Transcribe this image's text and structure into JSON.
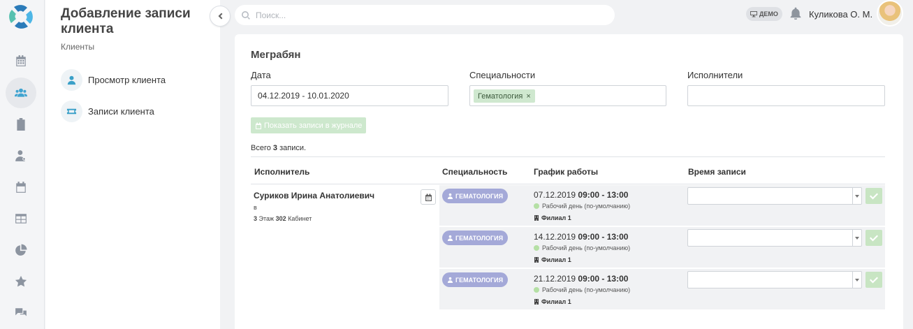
{
  "sidebar": {
    "items": [
      {
        "icon": "calendar-icon",
        "active": false
      },
      {
        "icon": "users-icon",
        "active": true
      },
      {
        "icon": "clipboard-icon",
        "active": false
      },
      {
        "icon": "user-doctor-icon",
        "active": false
      },
      {
        "icon": "calendar-schedule-icon",
        "active": false
      },
      {
        "icon": "table-icon",
        "active": false
      },
      {
        "icon": "pie-chart-icon",
        "active": false
      },
      {
        "icon": "star-icon",
        "active": false
      },
      {
        "icon": "chat-icon",
        "active": false
      }
    ]
  },
  "panel": {
    "title": "Добавление записи клиента",
    "subtitle": "Клиенты",
    "links": [
      {
        "label": "Просмотр клиента",
        "icon": "user-icon"
      },
      {
        "label": "Записи клиента",
        "icon": "ticket-icon"
      }
    ]
  },
  "header": {
    "search_placeholder": "Поиск...",
    "demo_label": "ДЕМО",
    "user_name": "Куликова О. М."
  },
  "main": {
    "client_name": "Меграбян",
    "date_label": "Дата",
    "date_value": "04.12.2019 - 10.01.2020",
    "specialties_label": "Специальности",
    "specialty_chip": "Гематология",
    "specialty_chip_remove": "×",
    "performers_label": "Исполнители",
    "performers_value": "",
    "show_button": "Показать записи в журнале",
    "total_prefix": "Всего",
    "total_count": "3",
    "total_suffix": "записи.",
    "columns": [
      "Исполнитель",
      "Специальность",
      "График работы",
      "Время записи"
    ],
    "performer": {
      "name": "Суриков Ирина Анатолиевич",
      "b": "в",
      "floor": "3",
      "floor_label": "Этаж",
      "cabinet": "302",
      "cabinet_label": "Кабинет"
    },
    "slots": [
      {
        "specialty": "ГЕМАТОЛОГИЯ",
        "date": "07.12.2019",
        "time": "09:00 - 13:00",
        "status": "Рабочий день (по-умолчанию)",
        "branch": "Филиал 1",
        "selected_time": ""
      },
      {
        "specialty": "ГЕМАТОЛОГИЯ",
        "date": "14.12.2019",
        "time": "09:00 - 13:00",
        "status": "Рабочий день (по-умолчанию)",
        "branch": "Филиал 1",
        "selected_time": ""
      },
      {
        "specialty": "ГЕМАТОЛОГИЯ",
        "date": "21.12.2019",
        "time": "09:00 - 13:00",
        "status": "Рабочий день (по-умолчанию)",
        "branch": "Филиал 1",
        "selected_time": ""
      }
    ]
  },
  "colors": {
    "accent": "#3fa3d0",
    "chip_green": "#cfe8cf",
    "badge_purple": "#a4a9d8",
    "ok_green": "#c8e5c3"
  }
}
